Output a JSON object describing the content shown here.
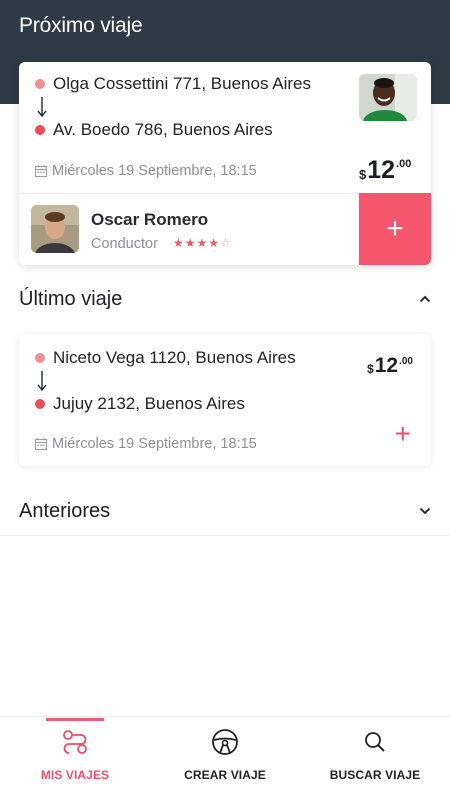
{
  "header": {
    "title": "Próximo viaje"
  },
  "next_trip": {
    "origin": "Olga Cossettini 771, Buenos Aires",
    "destination": "Av. Boedo 786, Buenos Aires",
    "date": "Miércoles 19 Septiembre, 18:15",
    "price": {
      "currency": "$",
      "integer": "12",
      "decimals": ".00"
    },
    "driver": {
      "name": "Oscar Romero",
      "role": "Conductor",
      "rating": 4,
      "rating_max": 5
    },
    "add_label": "+"
  },
  "last_trip": {
    "section_title": "Último viaje",
    "origin": "Niceto Vega 1120, Buenos Aires",
    "destination": "Jujuy 2132, Buenos Aires",
    "date": "Miércoles 19 Septiembre, 18:15",
    "price": {
      "currency": "$",
      "integer": "12",
      "decimals": ".00"
    },
    "add_label": "+"
  },
  "previous": {
    "section_title": "Anteriores"
  },
  "tabs": [
    {
      "label": "MIS VIAJES",
      "icon": "route-icon",
      "active": true
    },
    {
      "label": "CREAR VIAJE",
      "icon": "steering-wheel-icon",
      "active": false
    },
    {
      "label": "BUSCAR VIAJE",
      "icon": "search-icon",
      "active": false
    }
  ],
  "colors": {
    "header_bg": "#2e3a45",
    "accent": "#f5556d",
    "origin_dot": "#f08f96",
    "dest_dot": "#e84f5a"
  }
}
